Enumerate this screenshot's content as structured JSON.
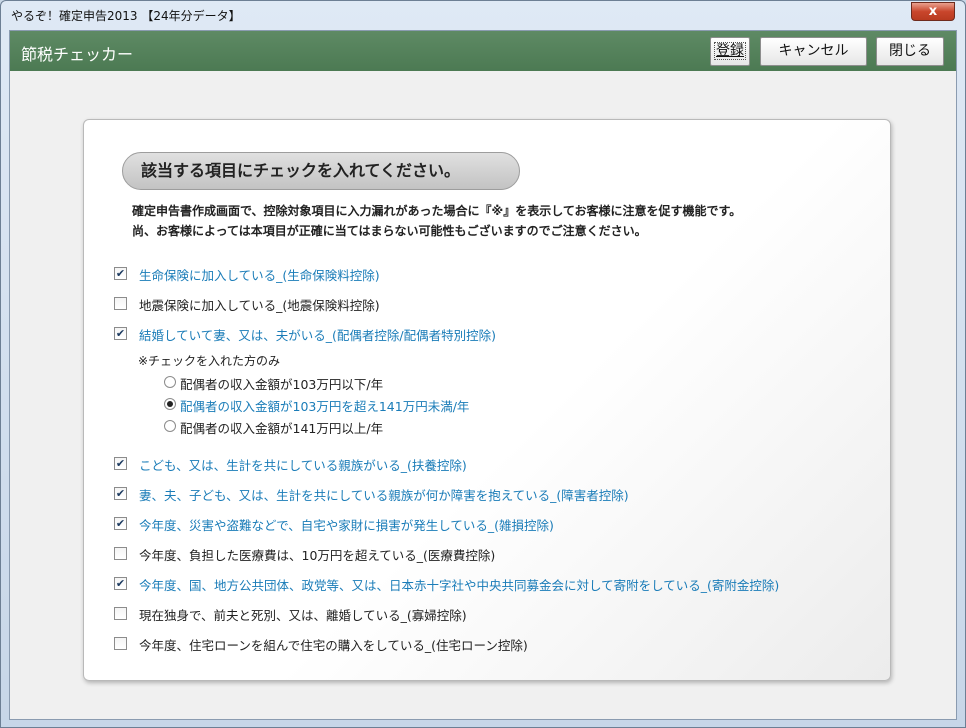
{
  "window": {
    "title": "やるぞ！確定申告2013 【24年分データ】",
    "close_glyph": "x"
  },
  "header": {
    "title": "節税チェッカー",
    "register_label": "登録",
    "cancel_label": "キャンセル",
    "close_label": "閉じる"
  },
  "panel": {
    "heading": "該当する項目にチェックを入れてください。",
    "desc1": "確定申告書作成画面で、控除対象項目に入力漏れがあった場合に『※』を表示してお客様に注意を促す機能です。",
    "desc2": "尚、お客様によっては本項目が正確に当てはまらない可能性もございますのでご注意ください。",
    "checkmark": "✔",
    "items": [
      {
        "label": "生命保険に加入している_(生命保険料控除)",
        "checked": true
      },
      {
        "label": "地震保険に加入している_(地震保険料控除)",
        "checked": false
      },
      {
        "label": "結婚していて妻、又は、夫がいる_(配偶者控除/配偶者特別控除)",
        "checked": true
      },
      {
        "label": "こども、又は、生計を共にしている親族がいる_(扶養控除)",
        "checked": true
      },
      {
        "label": "妻、夫、子ども、又は、生計を共にしている親族が何か障害を抱えている_(障害者控除)",
        "checked": true
      },
      {
        "label": "今年度、災害や盗難などで、自宅や家財に損害が発生している_(雑損控除)",
        "checked": true
      },
      {
        "label": "今年度、負担した医療費は、10万円を超えている_(医療費控除)",
        "checked": false
      },
      {
        "label": "今年度、国、地方公共団体、政党等、又は、日本赤十字社や中央共同募金会に対して寄附をしている_(寄附金控除)",
        "checked": true
      },
      {
        "label": "現在独身で、前夫と死別、又は、離婚している_(寡婦控除)",
        "checked": false
      },
      {
        "label": "今年度、住宅ローンを組んで住宅の購入をしている_(住宅ローン控除)",
        "checked": false
      }
    ],
    "spouse_note": "※チェックを入れた方のみ",
    "spouse_options": [
      {
        "label": "配偶者の収入金額が103万円以下/年",
        "selected": false
      },
      {
        "label": "配偶者の収入金額が103万円を超え141万円未満/年",
        "selected": true
      },
      {
        "label": "配偶者の収入金額が141万円以上/年",
        "selected": false
      }
    ]
  }
}
